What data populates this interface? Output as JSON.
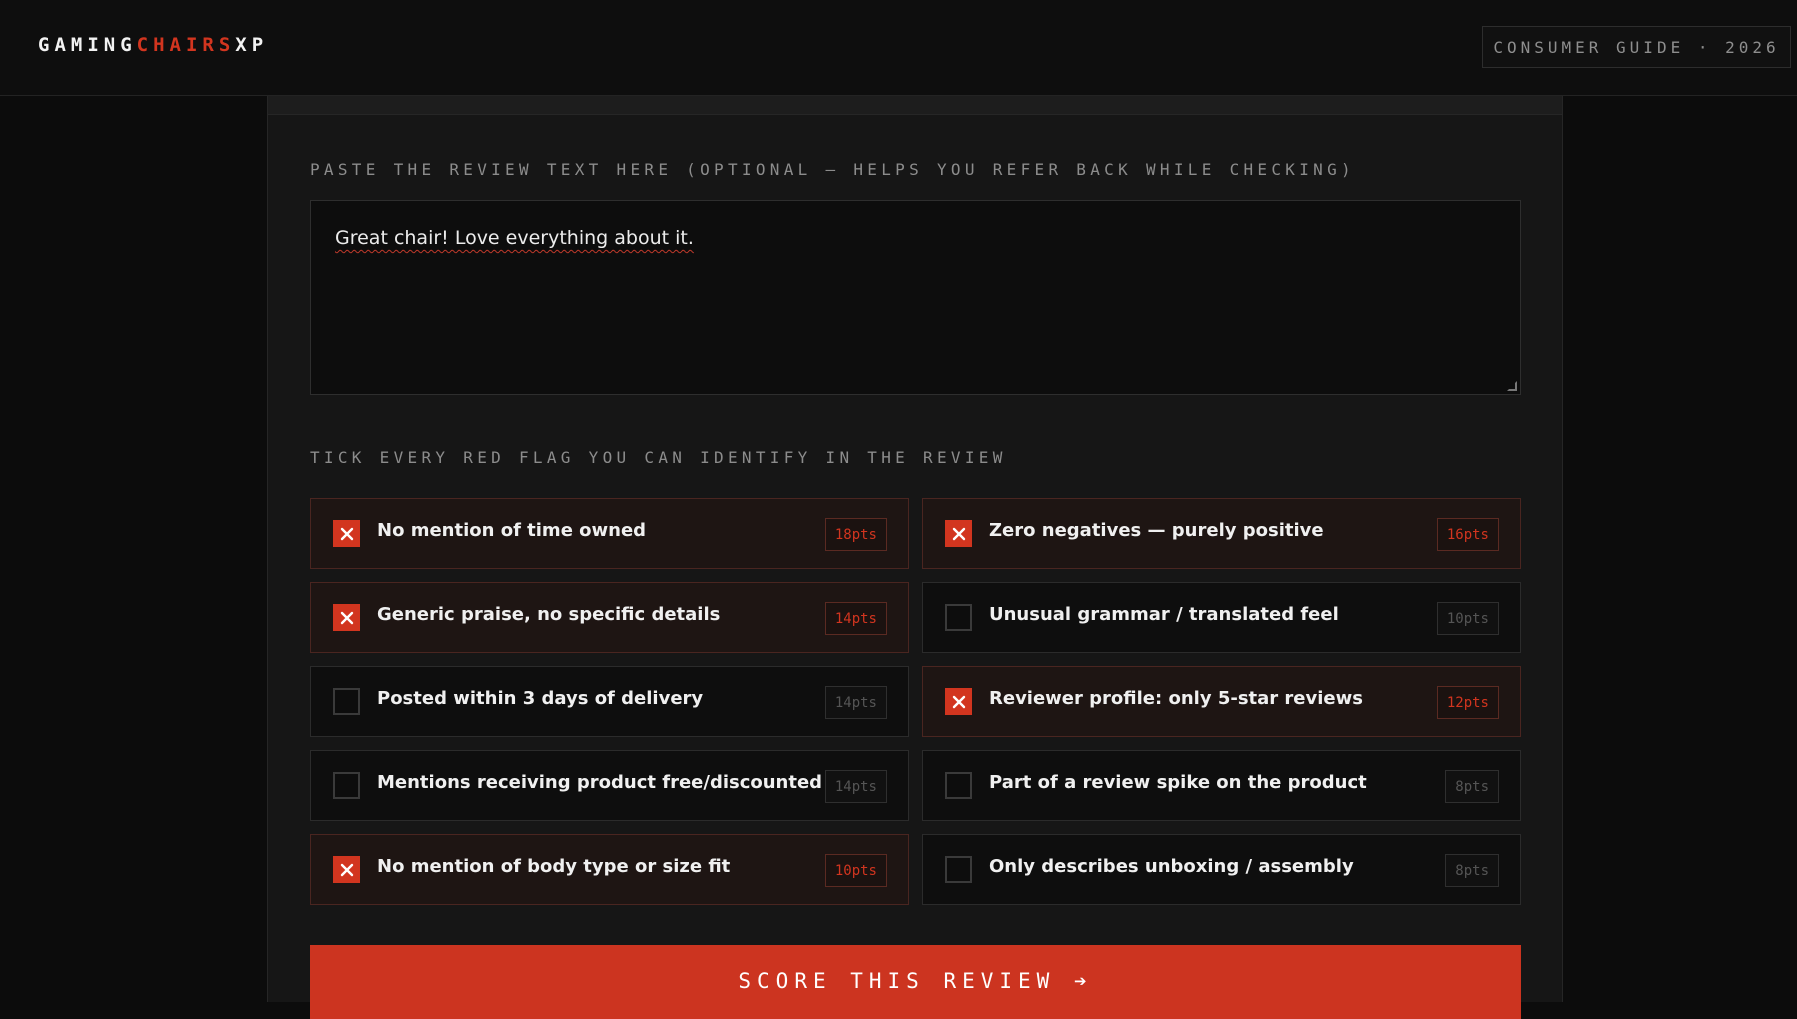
{
  "header": {
    "logo_part1": "GAMING",
    "logo_part2": "CHAIRS",
    "logo_part3": "XP",
    "badge": "CONSUMER GUIDE · 2026",
    "progress_fraction": 0.765,
    "accent_color": "#d2351f"
  },
  "review": {
    "label": "PASTE THE REVIEW TEXT HERE (OPTIONAL — HELPS YOU REFER BACK WHILE CHECKING)",
    "text": "Great chair! Love everything about it."
  },
  "flags_section": {
    "label": "TICK EVERY RED FLAG YOU CAN IDENTIFY IN THE REVIEW",
    "items": [
      {
        "label": "No mention of time owned",
        "points": "18pts",
        "checked": true
      },
      {
        "label": "Zero negatives — purely positive",
        "points": "16pts",
        "checked": true
      },
      {
        "label": "Generic praise, no specific details",
        "points": "14pts",
        "checked": true
      },
      {
        "label": "Unusual grammar / translated feel",
        "points": "10pts",
        "checked": false
      },
      {
        "label": "Posted within 3 days of delivery",
        "points": "14pts",
        "checked": false
      },
      {
        "label": "Reviewer profile: only 5-star reviews",
        "points": "12pts",
        "checked": true
      },
      {
        "label": "Mentions receiving product free/discounted",
        "points": "14pts",
        "checked": false
      },
      {
        "label": "Part of a review spike on the product",
        "points": "8pts",
        "checked": false
      },
      {
        "label": "No mention of body type or size fit",
        "points": "10pts",
        "checked": true
      },
      {
        "label": "Only describes unboxing / assembly",
        "points": "8pts",
        "checked": false
      }
    ]
  },
  "actions": {
    "score_label": "SCORE THIS REVIEW ➔"
  }
}
